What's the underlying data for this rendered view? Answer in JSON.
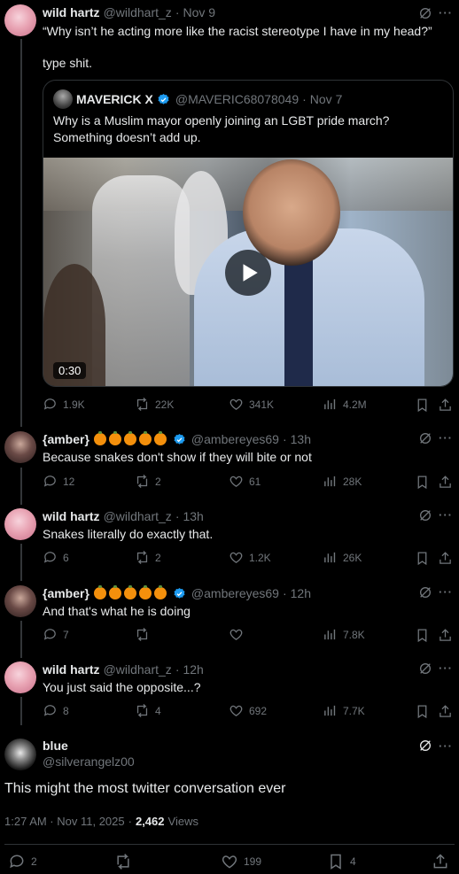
{
  "tweets": [
    {
      "name": "wild hartz",
      "handle": "@wildhart_z",
      "date": "Nov 9",
      "text_line1": "“Why isn’t he acting more like the racist stereotype I have in my head?”",
      "text_line2": "type shit.",
      "quote": {
        "name": "MAVERICK X",
        "handle": "@MAVERIC68078049",
        "date": "Nov 7",
        "text": "Why is a Muslim mayor openly joining an LGBT pride march? Something doesn’t add up.",
        "video_duration": "0:30"
      },
      "replies": "1.9K",
      "reposts": "22K",
      "likes": "341K",
      "views": "4.2M"
    },
    {
      "name": "{amber}",
      "handle": "@ambereyes69",
      "date": "13h",
      "text": "Because snakes don't show if they will bite or not",
      "replies": "12",
      "reposts": "2",
      "likes": "61",
      "views": "28K"
    },
    {
      "name": "wild hartz",
      "handle": "@wildhart_z",
      "date": "13h",
      "text": "Snakes literally do exactly that.",
      "replies": "6",
      "reposts": "2",
      "likes": "1.2K",
      "views": "26K"
    },
    {
      "name": "{amber}",
      "handle": "@ambereyes69",
      "date": "12h",
      "text": "And that's what he is doing",
      "replies": "7",
      "reposts": "",
      "likes": "",
      "views": "7.8K"
    },
    {
      "name": "wild hartz",
      "handle": "@wildhart_z",
      "date": "12h",
      "text": "You just said the opposite...?",
      "replies": "8",
      "reposts": "4",
      "likes": "692",
      "views": "7.7K"
    }
  ],
  "main": {
    "name": "blue",
    "handle": "@silverangelz00",
    "text": "This might the most twitter conversation ever",
    "time": "1:27 AM · Nov 11, 2025",
    "views_count": "2,462",
    "views_label": "Views",
    "replies": "2",
    "reposts": "",
    "likes": "199",
    "bookmarks": "4"
  },
  "dot_sep": "·",
  "more_glyph": "···",
  "play_icon": "play-icon",
  "colors": {
    "bg": "#000000",
    "text": "#e7e9ea",
    "muted": "#71767b",
    "verified": "#1d9bf0",
    "line": "#333639"
  }
}
